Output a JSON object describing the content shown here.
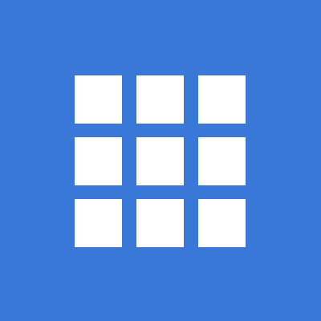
{
  "icon": {
    "name": "apps-grid-icon",
    "background_color": "#3a78d8",
    "tile_color": "#ffffff",
    "rows": 3,
    "columns": 3
  }
}
